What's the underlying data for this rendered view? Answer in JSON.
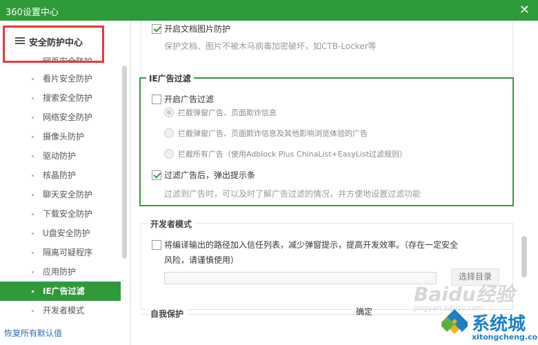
{
  "window": {
    "title": "360设置中心",
    "close_icon": "✕"
  },
  "sidebar": {
    "header": "安全防护中心",
    "partial_item": "网页安全防护",
    "items": [
      {
        "label": "看片安全防护"
      },
      {
        "label": "搜索安全防护"
      },
      {
        "label": "网络安全防护"
      },
      {
        "label": "摄像头防护"
      },
      {
        "label": "驱动防护"
      },
      {
        "label": "核晶防护"
      },
      {
        "label": "聊天安全防护"
      },
      {
        "label": "下载安全防护"
      },
      {
        "label": "U盘安全防护"
      },
      {
        "label": "隔离可疑程序"
      },
      {
        "label": "应用防护"
      },
      {
        "label": "IE广告过滤",
        "active": true
      },
      {
        "label": "开发者模式"
      }
    ],
    "reset_link": "恢复所有默认值"
  },
  "doc_protect": {
    "checkbox_label": "开启文档图片防护",
    "checked": true,
    "description": "保护文档、图片不被木马病毒加密破坏，如CTB-Locker等"
  },
  "ie_filter": {
    "section_title": "IE广告过滤",
    "enable_label": "开启广告过滤",
    "enable_checked": false,
    "radios": [
      {
        "label": "拦截弹窗广告、页面欺诈信息",
        "selected": true
      },
      {
        "label": "拦截弹窗广告、页面欺诈信息及其他影响浏览体验的广告",
        "selected": false
      },
      {
        "label": "拦截所有广告（使用Adblock Plus ChinaList+EasyList过滤规则）",
        "selected": false
      }
    ],
    "popup_label": "过滤广告后，弹出提示条",
    "popup_checked": true,
    "popup_description": "过滤到广告时，可以及时了解广告过滤的情况，并方便地设置过滤功能"
  },
  "developer": {
    "section_title": "开发者模式",
    "checkbox_label_line1": "将编译输出的路径加入信任列表，减少弹窗提示，提高开发效率。（存在一定安全",
    "checkbox_label_line2": "风险，请谨慎使用）",
    "checked": false,
    "path_value": "",
    "choose_dir_button": "选择目录"
  },
  "self_protect": {
    "section_title": "自我保护"
  },
  "footer": {
    "confirm_button": "确定"
  },
  "watermark": {
    "baidu": "Baidu经验",
    "jingyan": "jingyan.baidu.com"
  },
  "brand": {
    "name": "系统城",
    "url": "xitongcheng.com"
  },
  "colors": {
    "accent": "#2f9a3a",
    "highlight_box": "#e8353b",
    "link": "#2a6fb7"
  }
}
